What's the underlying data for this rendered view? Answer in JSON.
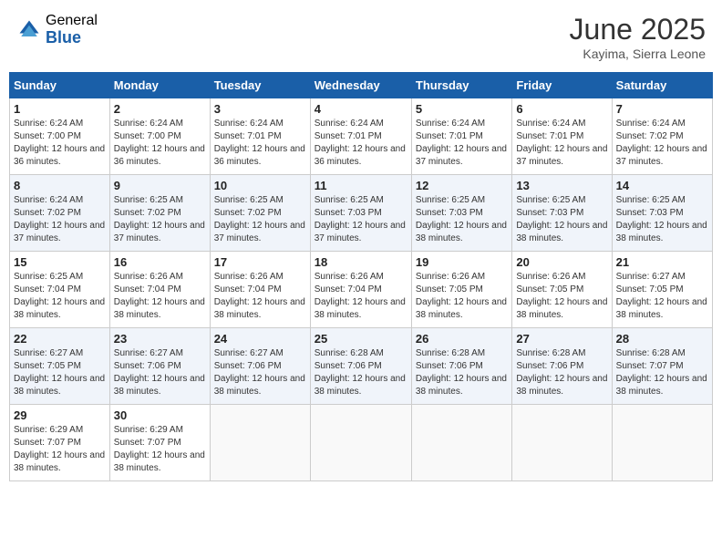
{
  "header": {
    "logo_general": "General",
    "logo_blue": "Blue",
    "month_title": "June 2025",
    "subtitle": "Kayima, Sierra Leone"
  },
  "days_of_week": [
    "Sunday",
    "Monday",
    "Tuesday",
    "Wednesday",
    "Thursday",
    "Friday",
    "Saturday"
  ],
  "weeks": [
    [
      {
        "day": "1",
        "sunrise": "6:24 AM",
        "sunset": "7:00 PM",
        "daylight": "12 hours and 36 minutes."
      },
      {
        "day": "2",
        "sunrise": "6:24 AM",
        "sunset": "7:00 PM",
        "daylight": "12 hours and 36 minutes."
      },
      {
        "day": "3",
        "sunrise": "6:24 AM",
        "sunset": "7:01 PM",
        "daylight": "12 hours and 36 minutes."
      },
      {
        "day": "4",
        "sunrise": "6:24 AM",
        "sunset": "7:01 PM",
        "daylight": "12 hours and 36 minutes."
      },
      {
        "day": "5",
        "sunrise": "6:24 AM",
        "sunset": "7:01 PM",
        "daylight": "12 hours and 37 minutes."
      },
      {
        "day": "6",
        "sunrise": "6:24 AM",
        "sunset": "7:01 PM",
        "daylight": "12 hours and 37 minutes."
      },
      {
        "day": "7",
        "sunrise": "6:24 AM",
        "sunset": "7:02 PM",
        "daylight": "12 hours and 37 minutes."
      }
    ],
    [
      {
        "day": "8",
        "sunrise": "6:24 AM",
        "sunset": "7:02 PM",
        "daylight": "12 hours and 37 minutes."
      },
      {
        "day": "9",
        "sunrise": "6:25 AM",
        "sunset": "7:02 PM",
        "daylight": "12 hours and 37 minutes."
      },
      {
        "day": "10",
        "sunrise": "6:25 AM",
        "sunset": "7:02 PM",
        "daylight": "12 hours and 37 minutes."
      },
      {
        "day": "11",
        "sunrise": "6:25 AM",
        "sunset": "7:03 PM",
        "daylight": "12 hours and 37 minutes."
      },
      {
        "day": "12",
        "sunrise": "6:25 AM",
        "sunset": "7:03 PM",
        "daylight": "12 hours and 38 minutes."
      },
      {
        "day": "13",
        "sunrise": "6:25 AM",
        "sunset": "7:03 PM",
        "daylight": "12 hours and 38 minutes."
      },
      {
        "day": "14",
        "sunrise": "6:25 AM",
        "sunset": "7:03 PM",
        "daylight": "12 hours and 38 minutes."
      }
    ],
    [
      {
        "day": "15",
        "sunrise": "6:25 AM",
        "sunset": "7:04 PM",
        "daylight": "12 hours and 38 minutes."
      },
      {
        "day": "16",
        "sunrise": "6:26 AM",
        "sunset": "7:04 PM",
        "daylight": "12 hours and 38 minutes."
      },
      {
        "day": "17",
        "sunrise": "6:26 AM",
        "sunset": "7:04 PM",
        "daylight": "12 hours and 38 minutes."
      },
      {
        "day": "18",
        "sunrise": "6:26 AM",
        "sunset": "7:04 PM",
        "daylight": "12 hours and 38 minutes."
      },
      {
        "day": "19",
        "sunrise": "6:26 AM",
        "sunset": "7:05 PM",
        "daylight": "12 hours and 38 minutes."
      },
      {
        "day": "20",
        "sunrise": "6:26 AM",
        "sunset": "7:05 PM",
        "daylight": "12 hours and 38 minutes."
      },
      {
        "day": "21",
        "sunrise": "6:27 AM",
        "sunset": "7:05 PM",
        "daylight": "12 hours and 38 minutes."
      }
    ],
    [
      {
        "day": "22",
        "sunrise": "6:27 AM",
        "sunset": "7:05 PM",
        "daylight": "12 hours and 38 minutes."
      },
      {
        "day": "23",
        "sunrise": "6:27 AM",
        "sunset": "7:06 PM",
        "daylight": "12 hours and 38 minutes."
      },
      {
        "day": "24",
        "sunrise": "6:27 AM",
        "sunset": "7:06 PM",
        "daylight": "12 hours and 38 minutes."
      },
      {
        "day": "25",
        "sunrise": "6:28 AM",
        "sunset": "7:06 PM",
        "daylight": "12 hours and 38 minutes."
      },
      {
        "day": "26",
        "sunrise": "6:28 AM",
        "sunset": "7:06 PM",
        "daylight": "12 hours and 38 minutes."
      },
      {
        "day": "27",
        "sunrise": "6:28 AM",
        "sunset": "7:06 PM",
        "daylight": "12 hours and 38 minutes."
      },
      {
        "day": "28",
        "sunrise": "6:28 AM",
        "sunset": "7:07 PM",
        "daylight": "12 hours and 38 minutes."
      }
    ],
    [
      {
        "day": "29",
        "sunrise": "6:29 AM",
        "sunset": "7:07 PM",
        "daylight": "12 hours and 38 minutes."
      },
      {
        "day": "30",
        "sunrise": "6:29 AM",
        "sunset": "7:07 PM",
        "daylight": "12 hours and 38 minutes."
      },
      null,
      null,
      null,
      null,
      null
    ]
  ]
}
